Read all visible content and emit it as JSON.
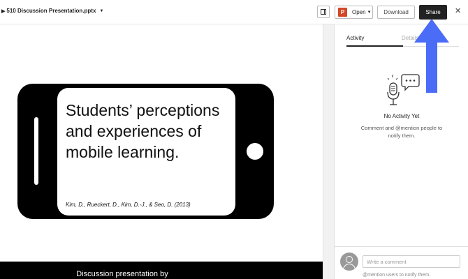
{
  "header": {
    "file_name": "510 Discussion Presentation.pptx",
    "open_label": "Open",
    "download_label": "Download",
    "share_label": "Share",
    "close_glyph": "✕"
  },
  "icons": {
    "expand": "triangle-right-icon",
    "file_menu": "chevron-down-icon",
    "panel_toggle": "sidebar-toggle-icon",
    "open_app": "powerpoint-icon",
    "close": "close-icon",
    "empty_state": "microphone-speech-bubble-icon",
    "avatar": "user-avatar-icon",
    "annotation": "arrow-up-icon"
  },
  "slide": {
    "title": "Students’ perceptions and experiences of mobile learning.",
    "citation": "Kim, D., Rueckert, D., Kim, D.-J., & Seo, D. (2013)",
    "next_slide_text": "Discussion presentation by"
  },
  "sidebar": {
    "tabs": [
      {
        "label": "Activity",
        "active": true
      },
      {
        "label": "Details",
        "active": false
      }
    ],
    "empty_title": "No Activity Yet",
    "empty_subtext": "Comment and @mention people to notify them.",
    "comment_placeholder": "Write a comment",
    "comment_hint": "@mention users to notify them."
  },
  "colors": {
    "share_button": "#222222",
    "powerpoint": "#d24726",
    "annotation_arrow": "#4a6cf7",
    "slide_frame": "#000000"
  }
}
